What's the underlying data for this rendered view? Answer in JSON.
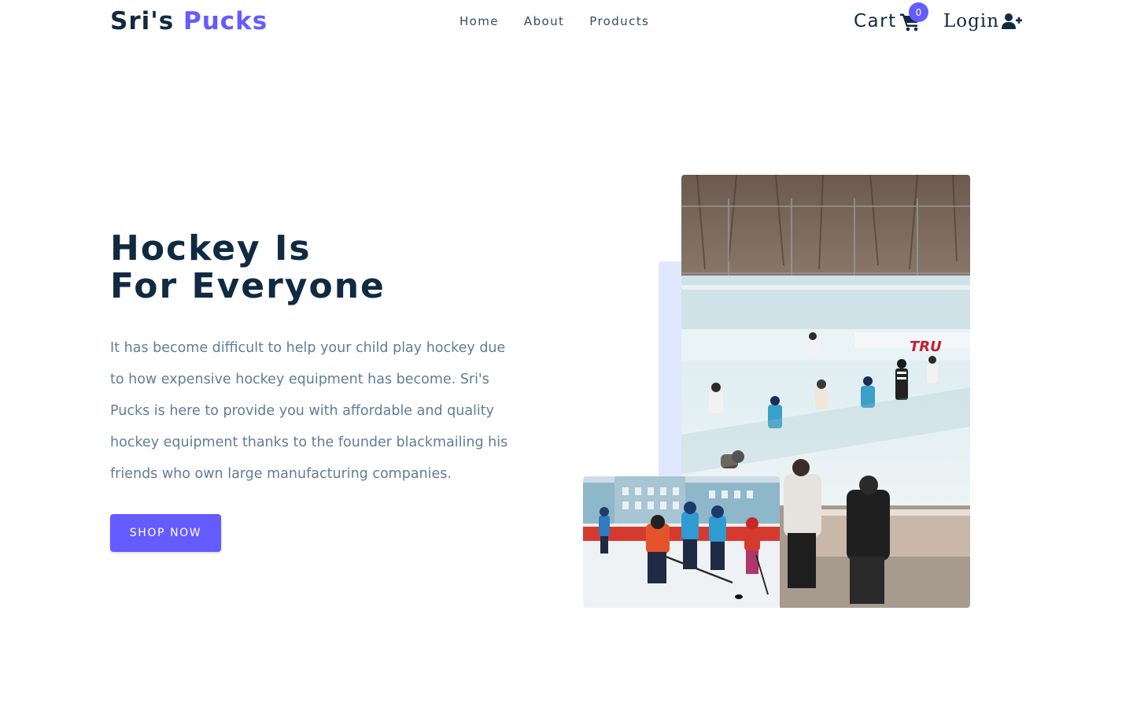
{
  "navbar": {
    "logo_part1": "Sri's",
    "logo_part2": "Pucks",
    "links": [
      "Home",
      "About",
      "Products"
    ],
    "cart_label": "Cart",
    "cart_count": "0",
    "login_label": "Login",
    "icons": {
      "cart": "shopping-cart-icon",
      "login": "user-plus-icon"
    }
  },
  "hero": {
    "title_line1": "Hockey Is",
    "title_line2": "For Everyone",
    "text": "It has become difficult to help your child play hockey due to how expensive hockey equipment has become. Sri's Pucks is here to provide you with affordable and quality hockey equipment thanks to the founder blackmailing his friends who own large manufacturing companies.",
    "button_label": "SHOP NOW"
  },
  "images": {
    "main_alt": "kids playing hockey on an outdoor rink",
    "accent_alt": "children in hockey gear on ice"
  },
  "colors": {
    "primary": "#645cff",
    "heading": "#102a42",
    "text": "#617d98",
    "accent_block": "#e0e8ff"
  }
}
